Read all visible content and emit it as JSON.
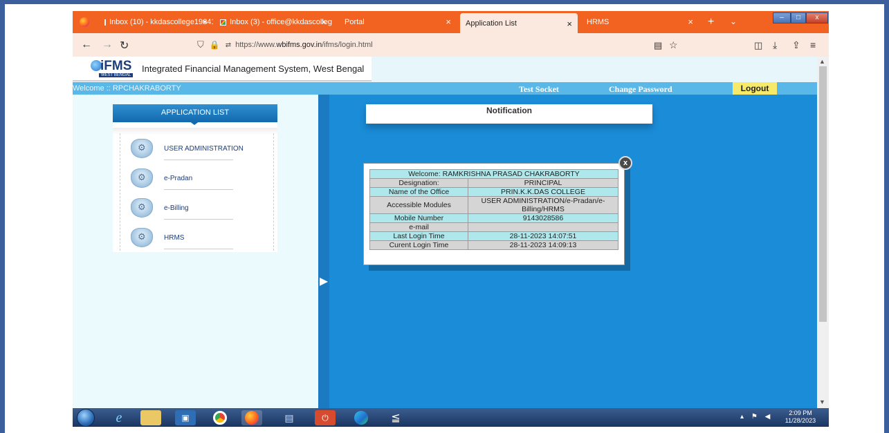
{
  "browser": {
    "tabs": [
      {
        "label": "Inbox (10) - kkdascollege19641",
        "active": false
      },
      {
        "label": "Inbox (3) - office@kkdascolleg",
        "active": false
      },
      {
        "label": "Portal",
        "active": false
      },
      {
        "label": "Application List",
        "active": true
      },
      {
        "label": "HRMS",
        "active": false
      }
    ],
    "url_prefix": "https://www.",
    "url_domain": "wbifms.gov.in",
    "url_path": "/ifms/login.html"
  },
  "site": {
    "logo_text": "iFMS",
    "logo_sub": "WEST BENGAL",
    "title": "Integrated Financial Management System, West Bengal"
  },
  "welcomebar": {
    "welcome": "Welcome :: RPCHAKRABORTY",
    "test_socket": "Test Socket",
    "change_password": "Change Password",
    "logout": "Logout"
  },
  "app_list": {
    "header": "APPLICATION LIST",
    "items": [
      {
        "label": "USER ADMINISTRATION"
      },
      {
        "label": "e-Pradan"
      },
      {
        "label": "e-Billing"
      },
      {
        "label": "HRMS"
      }
    ]
  },
  "notification": {
    "title": "Notification"
  },
  "popup": {
    "close": "x",
    "welcome_row": "Welcome:   RAMKRISHNA PRASAD CHAKRABORTY",
    "rows": [
      {
        "key": "Designation:",
        "value": "PRINCIPAL"
      },
      {
        "key": "Name of the Office",
        "value": "PRIN.K.K.DAS COLLEGE"
      },
      {
        "key": "Accessible Modules",
        "value": "USER ADMINISTRATION/e-Pradan/e-Billing/HRMS"
      },
      {
        "key": "Mobile Number",
        "value": "9143028586"
      },
      {
        "key": "e-mail",
        "value": ""
      },
      {
        "key": "Last Login Time",
        "value": "28-11-2023 14:07:51"
      },
      {
        "key": "Curent Login Time",
        "value": "28-11-2023 14:09:13"
      }
    ]
  },
  "taskbar": {
    "time": "2:09 PM",
    "date": "11/28/2023"
  }
}
